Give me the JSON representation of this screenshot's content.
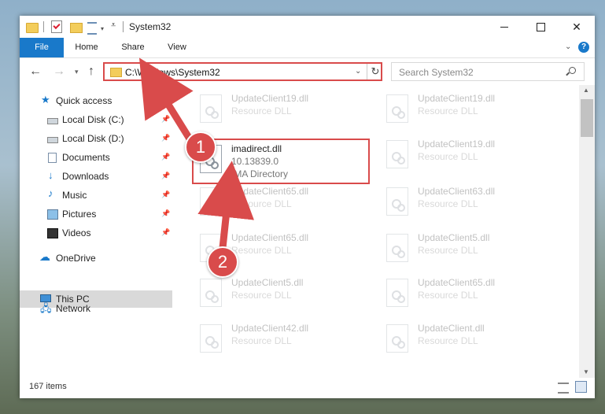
{
  "window": {
    "title": "System32"
  },
  "ribbon": {
    "tabs": [
      "File",
      "Home",
      "Share",
      "View"
    ],
    "help_label": "?"
  },
  "nav": {
    "address": "C:\\Windows\\System32",
    "search_placeholder": "Search System32"
  },
  "sidebar": {
    "items": [
      {
        "label": "Quick access",
        "icon": "star-icon"
      },
      {
        "label": "Local Disk (C:)",
        "icon": "drive-icon",
        "pinned": true
      },
      {
        "label": "Local Disk (D:)",
        "icon": "drive-icon",
        "pinned": true
      },
      {
        "label": "Documents",
        "icon": "documents-icon",
        "pinned": true
      },
      {
        "label": "Downloads",
        "icon": "download-icon",
        "pinned": true
      },
      {
        "label": "Music",
        "icon": "music-icon",
        "pinned": true
      },
      {
        "label": "Pictures",
        "icon": "pictures-icon",
        "pinned": true
      },
      {
        "label": "Videos",
        "icon": "video-icon",
        "pinned": true
      },
      {
        "label": "OneDrive",
        "icon": "cloud-icon"
      },
      {
        "label": "This PC",
        "icon": "computer-icon",
        "selected": true
      },
      {
        "label": "Network",
        "icon": "network-icon"
      }
    ]
  },
  "files": [
    {
      "name": "UpdateClient19.dll",
      "line2": "Resource DLL",
      "line3": ""
    },
    {
      "name": "UpdateClient19.dll",
      "line2": "Resource DLL",
      "line3": ""
    },
    {
      "name": "imadirect.dll",
      "line2": "10.13839.0",
      "line3": "IMA Directory",
      "highlighted": true
    },
    {
      "name": "UpdateClient19.dll",
      "line2": "Resource DLL",
      "line3": ""
    },
    {
      "name": "UpdateClient65.dll",
      "line2": "Resource DLL",
      "line3": ""
    },
    {
      "name": "UpdateClient63.dll",
      "line2": "Resource DLL",
      "line3": ""
    },
    {
      "name": "UpdateClient65.dll",
      "line2": "Resource DLL",
      "line3": ""
    },
    {
      "name": "UpdateClient5.dll",
      "line2": "Resource DLL",
      "line3": ""
    },
    {
      "name": "UpdateClient5.dll",
      "line2": "Resource DLL",
      "line3": ""
    },
    {
      "name": "UpdateClient65.dll",
      "line2": "Resource DLL",
      "line3": ""
    },
    {
      "name": "UpdateClient42.dll",
      "line2": "Resource DLL",
      "line3": ""
    },
    {
      "name": "UpdateClient.dll",
      "line2": "Resource DLL",
      "line3": ""
    }
  ],
  "status": {
    "item_count": "167 items"
  },
  "annotations": {
    "step1": "1",
    "step2": "2",
    "color": "#d94b4b"
  }
}
